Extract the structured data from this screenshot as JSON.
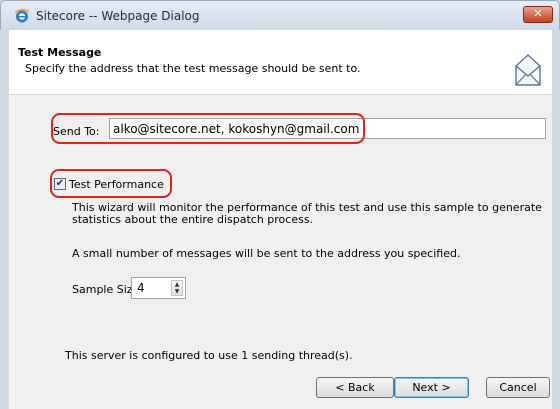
{
  "window": {
    "title": "Sitecore -- Webpage Dialog",
    "close_label": "✕"
  },
  "header": {
    "title": "Test Message",
    "subtitle": "Specify the address that the test message should be sent to."
  },
  "form": {
    "send_to_label": "Send To:",
    "send_to_value": "alko@sitecore.net, kokoshyn@gmail.com",
    "test_performance_label": "Test Performance",
    "test_performance_checked": true,
    "description_1": "This wizard will monitor the performance of this test and use this sample to generate statistics about the entire dispatch process.",
    "description_2": "A small number of messages will be sent to the address you specified.",
    "sample_size_label": "Sample Size:",
    "sample_size_value": "4"
  },
  "status": {
    "text": "This server is configured to use 1 sending thread(s)."
  },
  "buttons": {
    "back": "< Back",
    "next": "Next >",
    "cancel": "Cancel"
  },
  "colors": {
    "highlight": "#e2231a",
    "body_bg": "#f0f0f0"
  },
  "icons": {
    "title": "ie-icon",
    "header": "envelope-icon"
  }
}
